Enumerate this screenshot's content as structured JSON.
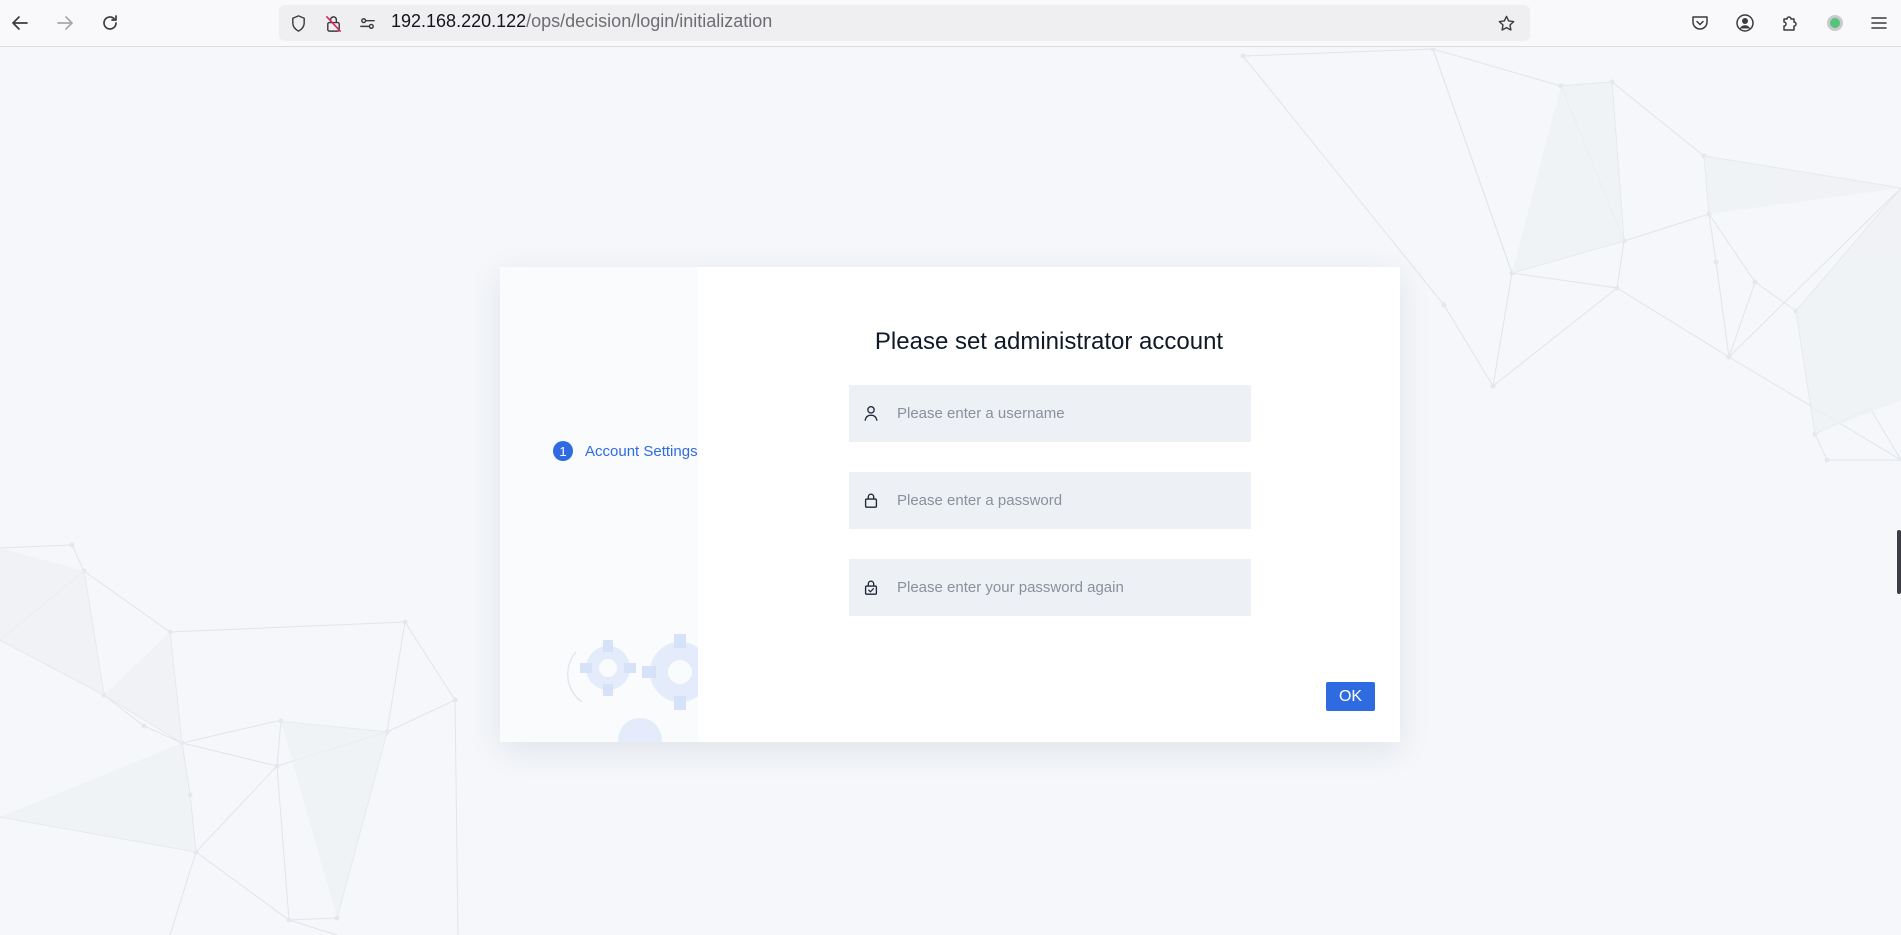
{
  "browser": {
    "url_host": "192.168.220.122",
    "url_path": "/ops/decision/login/initialization"
  },
  "dialog": {
    "title": "Please set administrator account",
    "steps": [
      {
        "number": "1",
        "label": "Account Settings"
      }
    ],
    "fields": {
      "username_placeholder": "Please enter a username",
      "password_placeholder": "Please enter a password",
      "confirm_placeholder": "Please enter your password again"
    },
    "ok_label": "OK"
  },
  "colors": {
    "accent": "#2f6be0",
    "background": "#f5f7fa",
    "field_bg": "#edf0f5"
  }
}
